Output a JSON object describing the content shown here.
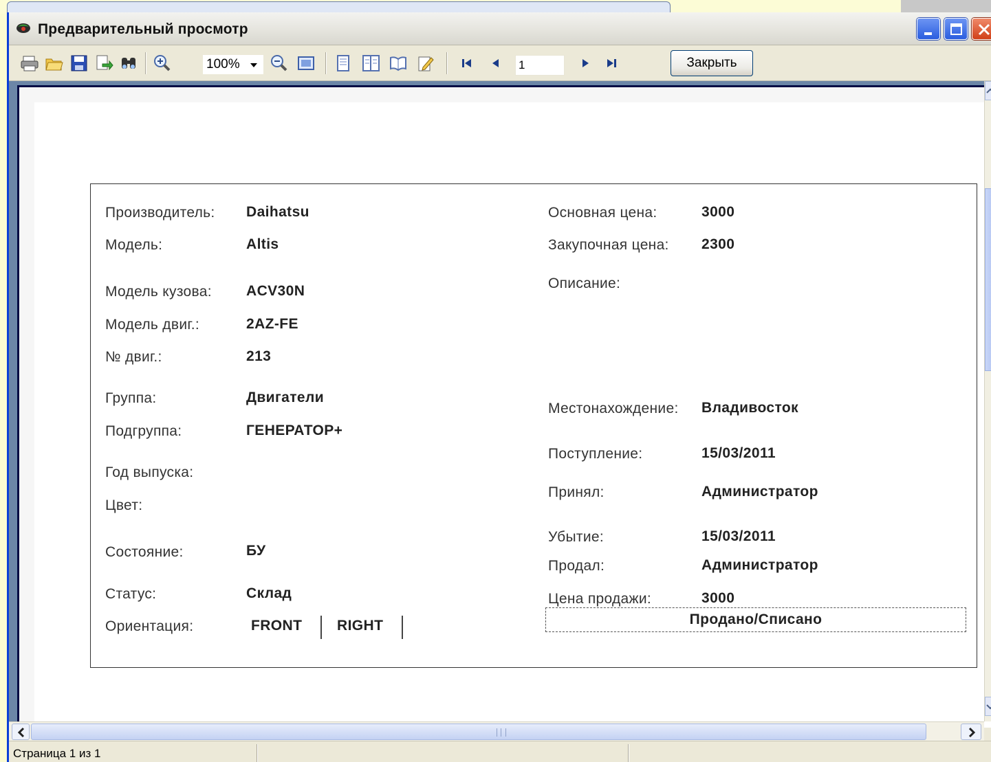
{
  "window": {
    "title": "Предварительный просмотр",
    "accent": "#0b3fd8"
  },
  "toolbar": {
    "zoom_value": "100%",
    "page_number": "1",
    "close_label": "Закрыть",
    "icons": [
      "print-icon",
      "open-icon",
      "save-icon",
      "export-icon",
      "find-icon",
      "zoom-in-icon",
      "zoom-out-icon",
      "whole-page-icon",
      "single-page-icon",
      "multi-page-icon",
      "book-icon",
      "edit-icon",
      "first-page-icon",
      "prev-page-icon",
      "next-page-icon",
      "last-page-icon"
    ]
  },
  "report": {
    "left": {
      "manufacturer": {
        "label": "Производитель:",
        "value": "Daihatsu"
      },
      "model": {
        "label": "Модель:",
        "value": "Altis"
      },
      "body_model": {
        "label": "Модель кузова:",
        "value": "ACV30N"
      },
      "engine_model": {
        "label": "Модель двиг.:",
        "value": "2AZ-FE"
      },
      "engine_no": {
        "label": "№ двиг.:",
        "value": "213"
      },
      "group": {
        "label": "Группа:",
        "value": "Двигатели"
      },
      "subgroup": {
        "label": "Подгруппа:",
        "value": "ГЕНЕРАТОР+"
      },
      "year": {
        "label": "Год выпуска:",
        "value": ""
      },
      "color": {
        "label": "Цвет:",
        "value": ""
      },
      "condition": {
        "label": "Состояние:",
        "value": "БУ"
      },
      "status": {
        "label": "Статус:",
        "value": "Склад"
      },
      "orientation": {
        "label": "Ориентация:",
        "values": [
          "FRONT",
          "RIGHT"
        ]
      }
    },
    "right": {
      "base_price": {
        "label": "Основная цена:",
        "value": "3000"
      },
      "purchase_price": {
        "label": "Закупочная цена:",
        "value": "2300"
      },
      "description": {
        "label": "Описание:",
        "value": ""
      },
      "location": {
        "label": "Местонахождение:",
        "value": "Владивосток"
      },
      "arrival": {
        "label": "Поступление:",
        "value": "15/03/2011"
      },
      "received_by": {
        "label": "Принял:",
        "value": "Администратор"
      },
      "departure": {
        "label": "Убытие:",
        "value": "15/03/2011"
      },
      "sold_by": {
        "label": "Продал:",
        "value": "Администратор"
      },
      "sale_price": {
        "label": "Цена продажи:",
        "value": "3000"
      },
      "sold_stamp": "Продано/Списано"
    }
  },
  "statusbar": {
    "page_info": "Страница 1 из 1"
  }
}
